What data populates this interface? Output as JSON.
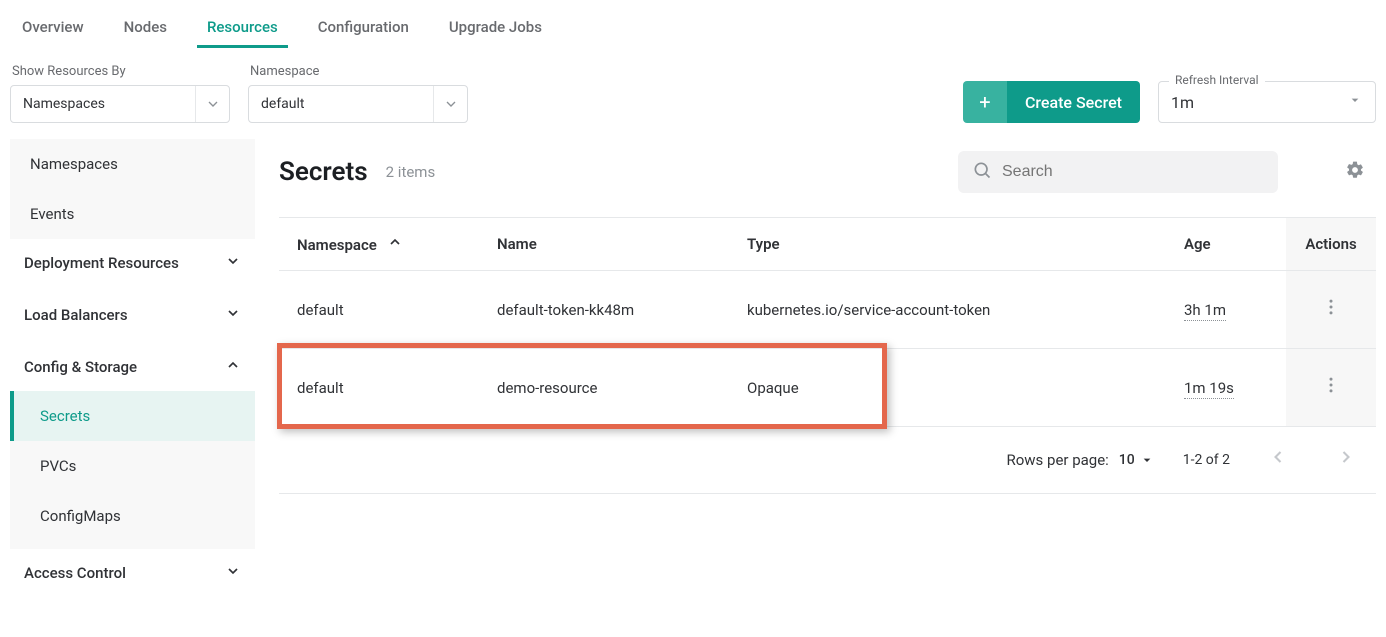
{
  "tabs": {
    "items": [
      {
        "label": "Overview",
        "active": false
      },
      {
        "label": "Nodes",
        "active": false
      },
      {
        "label": "Resources",
        "active": true
      },
      {
        "label": "Configuration",
        "active": false
      },
      {
        "label": "Upgrade Jobs",
        "active": false
      }
    ]
  },
  "filters": {
    "show_by_label": "Show Resources By",
    "show_by_value": "Namespaces",
    "ns_label": "Namespace",
    "ns_value": "default"
  },
  "create_button": {
    "label": "Create Secret"
  },
  "refresh": {
    "legend": "Refresh Interval",
    "value": "1m"
  },
  "sidebar": {
    "items": [
      {
        "label": "Namespaces"
      },
      {
        "label": "Events"
      }
    ],
    "groups": [
      {
        "label": "Deployment Resources",
        "expanded": false,
        "children": []
      },
      {
        "label": "Load Balancers",
        "expanded": false,
        "children": []
      },
      {
        "label": "Config & Storage",
        "expanded": true,
        "children": [
          {
            "label": "Secrets",
            "active": true
          },
          {
            "label": "PVCs",
            "active": false
          },
          {
            "label": "ConfigMaps",
            "active": false
          }
        ]
      },
      {
        "label": "Access Control",
        "expanded": false,
        "children": []
      }
    ]
  },
  "main": {
    "title": "Secrets",
    "count_label": "2 items",
    "search_placeholder": "Search",
    "columns": {
      "namespace": "Namespace",
      "name": "Name",
      "type": "Type",
      "age": "Age",
      "actions": "Actions"
    },
    "sort_column": "namespace",
    "rows": [
      {
        "namespace": "default",
        "name": "default-token-kk48m",
        "type": "kubernetes.io/service-account-token",
        "age": "3h 1m"
      },
      {
        "namespace": "default",
        "name": "demo-resource",
        "type": "Opaque",
        "age": "1m 19s"
      }
    ],
    "highlight_row_index": 1
  },
  "pagination": {
    "rpp_label": "Rows per page:",
    "rpp_value": "10",
    "range_label": "1-2 of 2"
  }
}
